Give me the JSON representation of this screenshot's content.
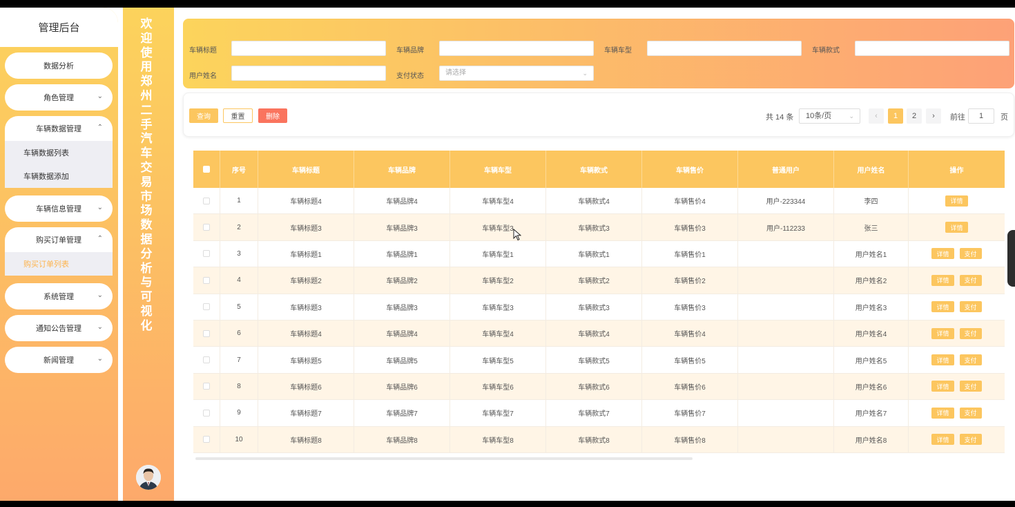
{
  "sidebar": {
    "title": "管理后台",
    "menu": {
      "data_analysis": "数据分析",
      "role_mgmt": "角色管理",
      "car_data_mgmt": "车辆数据管理",
      "car_data_list": "车辆数据列表",
      "car_data_add": "车辆数据添加",
      "car_info_mgmt": "车辆信息管理",
      "order_mgmt": "购买订单管理",
      "order_list": "购买订单列表",
      "system_mgmt": "系统管理",
      "notice_mgmt": "通知公告管理",
      "news_mgmt": "新闻管理"
    }
  },
  "banner": {
    "text": "欢迎使用郑州二手汽车交易市场数据分析与可视化"
  },
  "search": {
    "title_label": "车辆标题",
    "brand_label": "车辆品牌",
    "model_label": "车辆车型",
    "style_label": "车辆款式",
    "username_label": "用户姓名",
    "pay_label": "支付状态",
    "pay_placeholder": "请选择"
  },
  "toolbar": {
    "query": "查询",
    "reset": "重置",
    "delete": "删除",
    "total": "共 14 条",
    "page_size": "10条/页",
    "prev": "‹",
    "next": "›",
    "pages": [
      "1",
      "2"
    ],
    "goto_label": "前往",
    "goto_value": "1",
    "goto_unit": "页"
  },
  "table": {
    "headers": [
      "序号",
      "车辆标题",
      "车辆品牌",
      "车辆车型",
      "车辆款式",
      "车辆售价",
      "普通用户",
      "用户姓名",
      "操作"
    ],
    "detail_btn": "详情",
    "pay_btn": "支付",
    "rows": [
      {
        "idx": "1",
        "title": "车辆标题4",
        "brand": "车辆品牌4",
        "model": "车辆车型4",
        "style": "车辆款式4",
        "price": "车辆售价4",
        "user": "用户-223344",
        "name": "李四",
        "pay": false
      },
      {
        "idx": "2",
        "title": "车辆标题3",
        "brand": "车辆品牌3",
        "model": "车辆车型3",
        "style": "车辆款式3",
        "price": "车辆售价3",
        "user": "用户-112233",
        "name": "张三",
        "pay": false
      },
      {
        "idx": "3",
        "title": "车辆标题1",
        "brand": "车辆品牌1",
        "model": "车辆车型1",
        "style": "车辆款式1",
        "price": "车辆售价1",
        "user": "",
        "name": "用户姓名1",
        "pay": true
      },
      {
        "idx": "4",
        "title": "车辆标题2",
        "brand": "车辆品牌2",
        "model": "车辆车型2",
        "style": "车辆款式2",
        "price": "车辆售价2",
        "user": "",
        "name": "用户姓名2",
        "pay": true
      },
      {
        "idx": "5",
        "title": "车辆标题3",
        "brand": "车辆品牌3",
        "model": "车辆车型3",
        "style": "车辆款式3",
        "price": "车辆售价3",
        "user": "",
        "name": "用户姓名3",
        "pay": true
      },
      {
        "idx": "6",
        "title": "车辆标题4",
        "brand": "车辆品牌4",
        "model": "车辆车型4",
        "style": "车辆款式4",
        "price": "车辆售价4",
        "user": "",
        "name": "用户姓名4",
        "pay": true
      },
      {
        "idx": "7",
        "title": "车辆标题5",
        "brand": "车辆品牌5",
        "model": "车辆车型5",
        "style": "车辆款式5",
        "price": "车辆售价5",
        "user": "",
        "name": "用户姓名5",
        "pay": true
      },
      {
        "idx": "8",
        "title": "车辆标题6",
        "brand": "车辆品牌6",
        "model": "车辆车型6",
        "style": "车辆款式6",
        "price": "车辆售价6",
        "user": "",
        "name": "用户姓名6",
        "pay": true
      },
      {
        "idx": "9",
        "title": "车辆标题7",
        "brand": "车辆品牌7",
        "model": "车辆车型7",
        "style": "车辆款式7",
        "price": "车辆售价7",
        "user": "",
        "name": "用户姓名7",
        "pay": true
      },
      {
        "idx": "10",
        "title": "车辆标题8",
        "brand": "车辆品牌8",
        "model": "车辆车型8",
        "style": "车辆款式8",
        "price": "车辆售价8",
        "user": "",
        "name": "用户姓名8",
        "pay": true
      }
    ]
  },
  "colors": {
    "accent": "#fcc65f",
    "danger": "#fa745e",
    "row_alt": "#fff5e6"
  }
}
